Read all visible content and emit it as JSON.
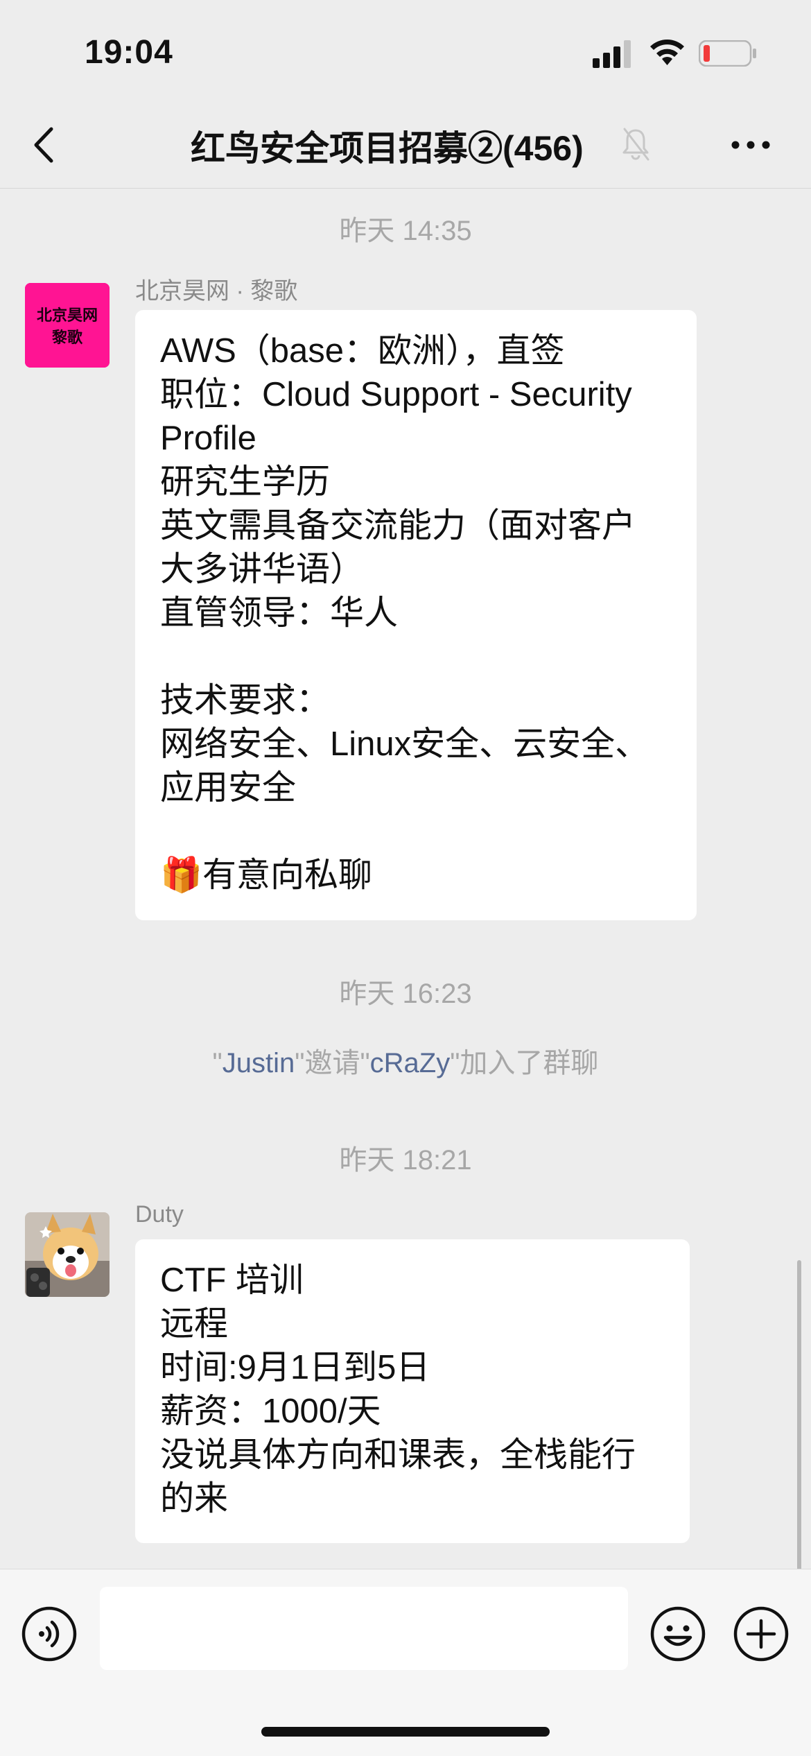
{
  "status_bar": {
    "time": "19:04",
    "battery_level": 0.12,
    "battery_color": "#f23b3b"
  },
  "header": {
    "title": "红鸟安全项目招募②(456)",
    "muted": true
  },
  "chat": {
    "time_1": "昨天 14:35",
    "msg_1": {
      "sender": "北京昊网 · 黎歌",
      "avatar_text": [
        "北京昊网",
        "黎歌"
      ],
      "avatar_color": "#ff1493",
      "lines": [
        "AWS（base：欧洲），直签",
        "职位：Cloud Support - Security",
        "Profile",
        "研究生学历",
        "英文需具备交流能力（面对客户",
        "大多讲华语）",
        "直管领导：华人",
        "",
        "技术要求：",
        "网络安全、Linux安全、云安全、",
        "应用安全",
        "",
        "🎁有意向私聊"
      ]
    },
    "time_2": "昨天 16:23",
    "system": {
      "q1": "\"",
      "inviter": "Justin",
      "q2": "\"邀请\"",
      "invitee": "cRaZy",
      "q3": "\"加入了群聊"
    },
    "time_3": "昨天 18:21",
    "msg_2": {
      "sender": "Duty",
      "avatar_icon": "dog-photo",
      "lines": [
        "CTF 培训",
        "远程",
        "时间:9月1日到5日",
        "薪资：1000/天",
        "没说具体方向和课表，全栈能行",
        "的来"
      ]
    }
  },
  "input_bar": {
    "placeholder": "",
    "voice_icon": "voice-icon",
    "emoji_icon": "emoji-icon",
    "plus_icon": "plus-icon"
  },
  "colors": {
    "background": "#ededed",
    "bubble": "#ffffff",
    "link": "#576b95",
    "meta": "#a7a7a7"
  }
}
